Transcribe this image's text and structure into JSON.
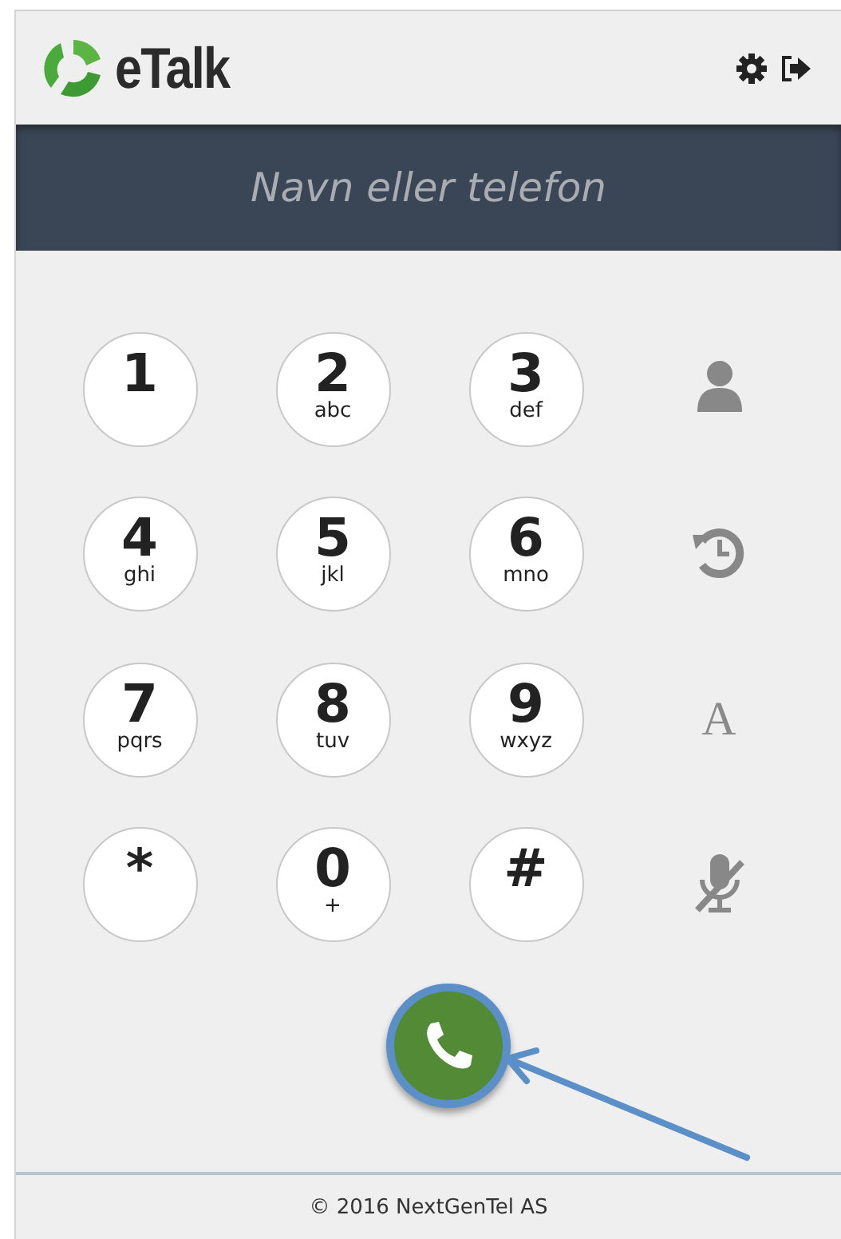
{
  "header": {
    "logo_text": "eTalk"
  },
  "search": {
    "placeholder": "Navn eller telefon"
  },
  "keys": [
    {
      "digit": "1"
    },
    {
      "digit": "2",
      "letters": "abc"
    },
    {
      "digit": "3",
      "letters": "def"
    },
    {
      "digit": "4",
      "letters": "ghi"
    },
    {
      "digit": "5",
      "letters": "jkl"
    },
    {
      "digit": "6",
      "letters": "mno"
    },
    {
      "digit": "7",
      "letters": "pqrs"
    },
    {
      "digit": "8",
      "letters": "tuv"
    },
    {
      "digit": "9",
      "letters": "wxyz"
    },
    {
      "digit": "*"
    },
    {
      "digit": "0",
      "letters": "+"
    },
    {
      "digit": "#"
    }
  ],
  "side_actions": [
    {
      "kind": "contacts"
    },
    {
      "kind": "history"
    },
    {
      "kind": "font",
      "label": "A"
    },
    {
      "kind": "mute"
    }
  ],
  "footer": {
    "text": "© 2016 NextGenTel AS"
  }
}
